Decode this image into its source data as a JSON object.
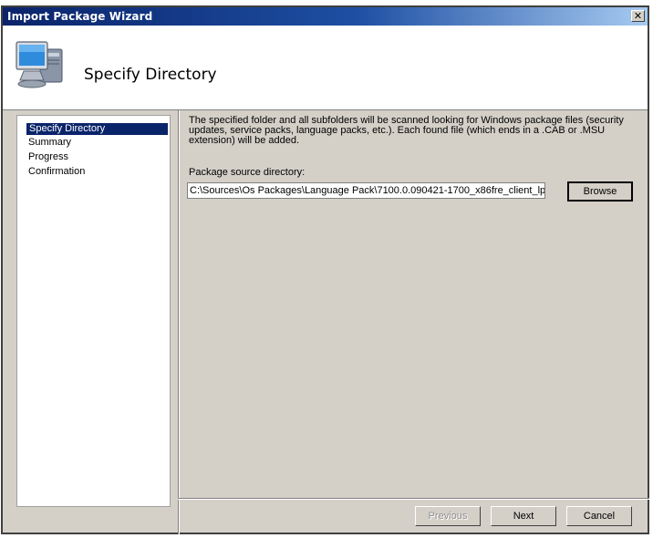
{
  "window": {
    "title": "Import Package Wizard",
    "close_glyph": "✕"
  },
  "header": {
    "title": "Specify Directory",
    "icon": "computer-icon"
  },
  "nav": {
    "items": [
      {
        "label": "Specify Directory",
        "selected": true
      },
      {
        "label": "Summary",
        "selected": false
      },
      {
        "label": "Progress",
        "selected": false
      },
      {
        "label": "Confirmation",
        "selected": false
      }
    ]
  },
  "main": {
    "description": "The specified folder and all subfolders will be scanned looking for Windows package files (security updates, service packs, language packs, etc.).  Each found file (which ends in a .CAB or .MSU extension) will be added.",
    "source_label": "Package source directory:",
    "source_value": "C:\\Sources\\Os Packages\\Language Pack\\7100.0.090421-1700_x86fre_client_lp_",
    "browse_label": "Browse"
  },
  "footer": {
    "previous_label": "Previous",
    "next_label": "Next",
    "cancel_label": "Cancel"
  },
  "colors": {
    "titlebar": "#0a246a",
    "selection": "#0a246a",
    "face": "#d4d0c8"
  }
}
